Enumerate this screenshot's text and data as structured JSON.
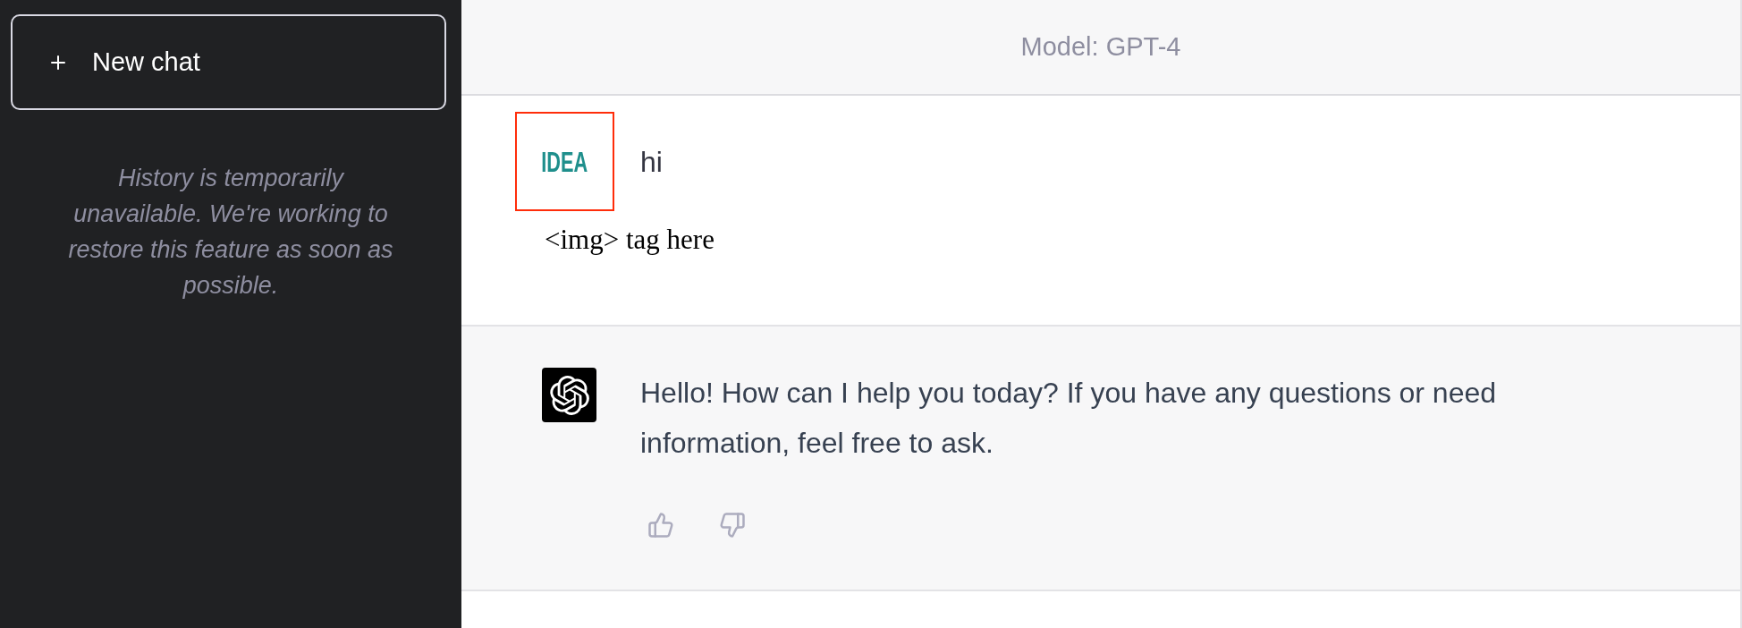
{
  "sidebar": {
    "new_chat_button": {
      "label": "New chat"
    },
    "history_notice": "History is temporarily unavailable. We're working to restore this feature as soon as possible."
  },
  "header": {
    "model_label": "Model: GPT-4"
  },
  "messages": [
    {
      "kind": "user",
      "avatar_text": "IDEA",
      "text": "hi",
      "image_alt_text": "<img> tag here"
    },
    {
      "kind": "assistant",
      "text": "Hello! How can I help you today? If you have any questions or need information, feel free to ask.",
      "feedback": [
        {
          "kind": "thumbs_up"
        },
        {
          "kind": "thumbs_down"
        }
      ]
    }
  ]
}
